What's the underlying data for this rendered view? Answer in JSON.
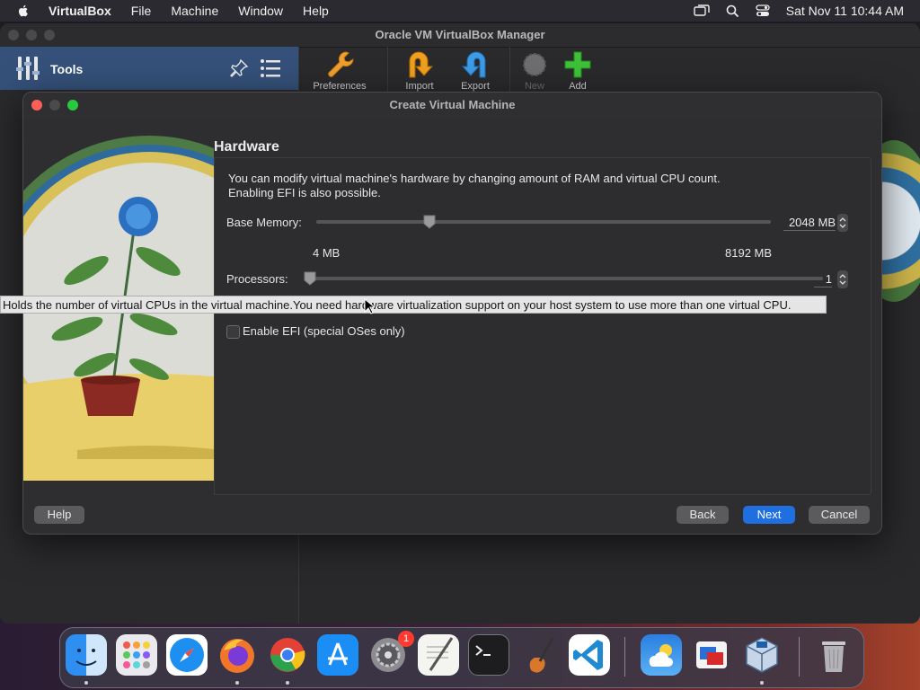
{
  "menubar": {
    "app_name": "VirtualBox",
    "menus": [
      "File",
      "Machine",
      "Window",
      "Help"
    ],
    "clock": "Sat Nov 11  10:44 AM"
  },
  "main_window": {
    "title": "Oracle VM VirtualBox Manager",
    "tools_label": "Tools",
    "toolbar": [
      {
        "label": "Preferences",
        "enabled": true
      },
      {
        "label": "Import",
        "enabled": true
      },
      {
        "label": "Export",
        "enabled": true
      },
      {
        "label": "New",
        "enabled": false
      },
      {
        "label": "Add",
        "enabled": true
      }
    ]
  },
  "dialog": {
    "title": "Create Virtual Machine",
    "heading": "Hardware",
    "description_line1": "You can modify virtual machine's hardware by changing amount of RAM and virtual CPU count.",
    "description_line2": "Enabling EFI is also possible.",
    "base_memory": {
      "label": "Base Memory:",
      "value_text": "2048 MB",
      "value": 2048,
      "min_label": "4 MB",
      "max_label": "8192 MB"
    },
    "processors": {
      "label": "Processors:",
      "value_text": "1",
      "value": 1
    },
    "efi": {
      "label": "Enable EFI (special OSes only)",
      "checked": false
    },
    "buttons": {
      "help": "Help",
      "back": "Back",
      "next": "Next",
      "cancel": "Cancel"
    }
  },
  "tooltip": "Holds the number of virtual CPUs in the virtual machine.You need hardware virtualization support on your host system to use more than one virtual CPU.",
  "dock": {
    "apps": [
      "finder",
      "launchpad",
      "safari",
      "firefox",
      "chrome",
      "app-store",
      "system-settings",
      "textedit",
      "terminal",
      "garageband",
      "vscode",
      "weather",
      "remote-desktop",
      "virtualbox",
      "trash"
    ],
    "settings_badge": "1"
  },
  "colors": {
    "accent": "#1f6fe0",
    "tools_pane": "#35517a"
  }
}
